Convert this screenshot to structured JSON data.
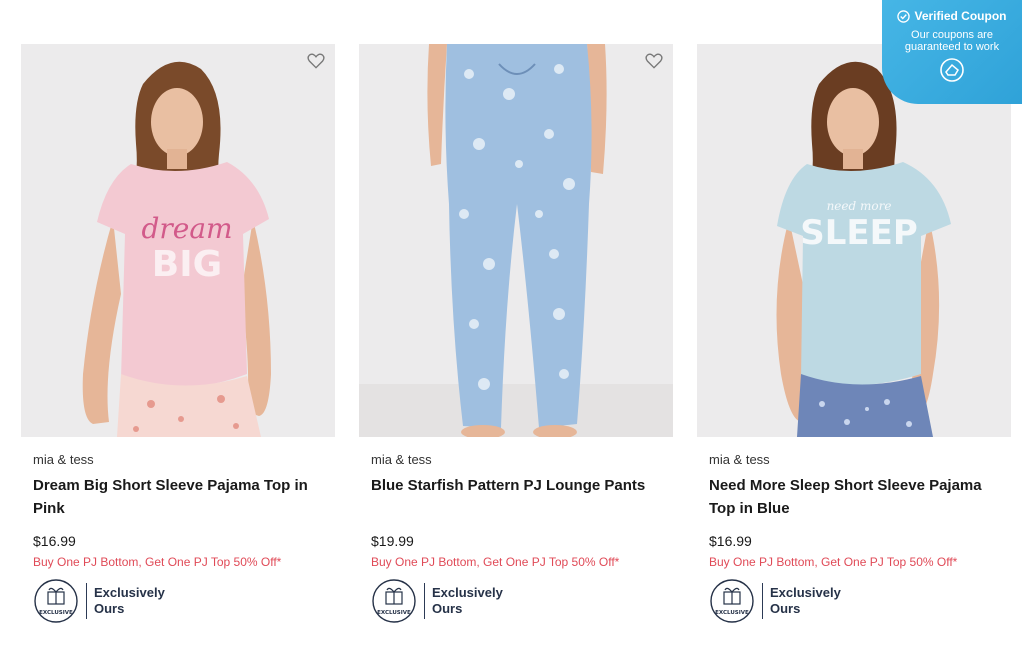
{
  "products": [
    {
      "brand": "mia & tess",
      "title": "Dream Big Short Sleeve Pajama Top in Pink",
      "price": "$16.99",
      "promo": "Buy One PJ Bottom, Get One PJ Top 50% Off*",
      "badge_line1": "Exclusively",
      "badge_line2": "Ours",
      "seal_text": "EXCLUSIVE",
      "shirt_text1": "dream",
      "shirt_text2": "BIG",
      "icon": "heart-icon"
    },
    {
      "brand": "mia & tess",
      "title": "Blue Starfish Pattern PJ Lounge Pants",
      "price": "$19.99",
      "promo": "Buy One PJ Bottom, Get One PJ Top 50% Off*",
      "badge_line1": "Exclusively",
      "badge_line2": "Ours",
      "seal_text": "EXCLUSIVE",
      "icon": "heart-icon"
    },
    {
      "brand": "mia & tess",
      "title": "Need More Sleep Short Sleeve Pajama Top in Blue",
      "price": "$16.99",
      "promo": "Buy One PJ Bottom, Get One PJ Top 50% Off*",
      "badge_line1": "Exclusively",
      "badge_line2": "Ours",
      "seal_text": "EXCLUSIVE",
      "shirt_text1": "need more",
      "shirt_text2": "SLEEP",
      "icon": "heart-icon"
    }
  ],
  "coupon": {
    "title": "Verified Coupon",
    "subtitle": "Our coupons are guaranteed to work",
    "icons": [
      "check-circle-icon",
      "coupon-logo-icon"
    ]
  },
  "colors": {
    "promo": "#e04a57",
    "coupon_bg": "#3aaee0",
    "badge_text": "#263248"
  }
}
